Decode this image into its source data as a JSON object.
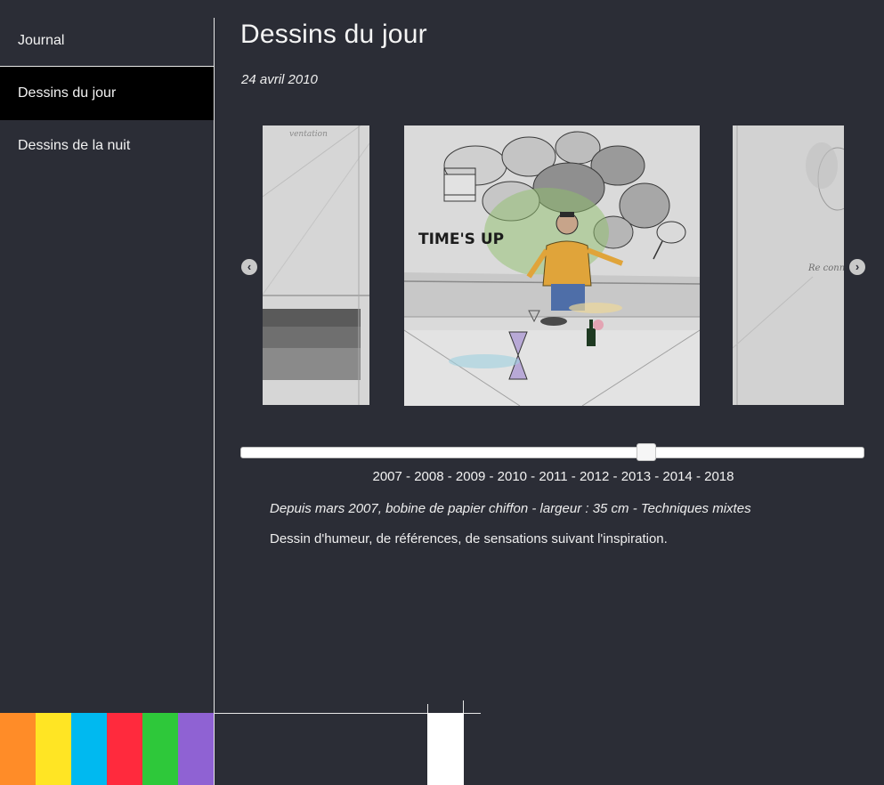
{
  "sidebar": {
    "items": [
      {
        "label": "Journal"
      },
      {
        "label": "Dessins du jour",
        "active": true
      },
      {
        "label": "Dessins de la nuit"
      }
    ]
  },
  "swatch_colors": [
    "#ff8c28",
    "#ffe524",
    "#00b9f0",
    "#ff2a3d",
    "#2ec83a",
    "#8f62d3"
  ],
  "main": {
    "title": "Dessins du jour",
    "date": "24 avril 2010",
    "carousel": {
      "prev_icon": "chevron-left-circle-icon",
      "next_icon": "chevron-right-circle-icon",
      "center_caption": "TIME'S UP",
      "left_caption": "ventation",
      "right_caption": "Re conn"
    },
    "slider": {
      "position_fraction": 0.655
    },
    "years": [
      "2007",
      "2008",
      "2009",
      "2010",
      "2011",
      "2012",
      "2013",
      "2014",
      "2018"
    ],
    "description_italic": "Depuis mars 2007, bobine de papier chiffon - largeur : 35 cm - Techniques mixtes",
    "description": "Dessin d'humeur, de références, de sensations suivant l'inspiration."
  }
}
